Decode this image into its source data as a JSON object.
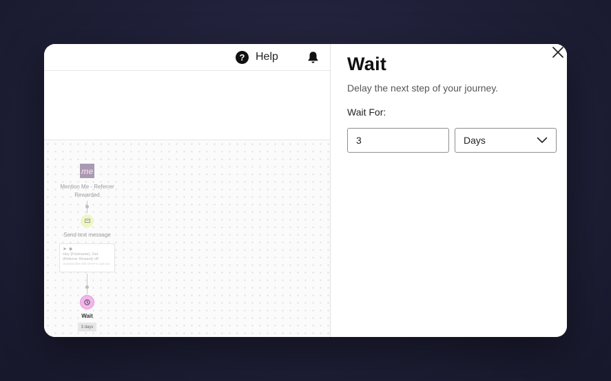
{
  "header": {
    "help_label": "Help",
    "help_icon": "question-circle-icon",
    "bell_icon": "bell-icon"
  },
  "journey": {
    "trigger": {
      "logo_text": "me",
      "title": "Mention Me - Referrer Rewarded"
    },
    "message": {
      "title": "Send text message",
      "preview": "Hey {Firstname}, Get {Referrer Reward} off",
      "preview_sub": "Unsubscribe with STOP to opt-out"
    },
    "wait": {
      "title": "Wait",
      "badge": "3 days"
    }
  },
  "panel": {
    "title": "Wait",
    "description": "Delay the next step of your journey.",
    "wait_for_label": "Wait For:",
    "amount_value": "3",
    "unit_value": "Days",
    "close_icon": "close-icon"
  },
  "colors": {
    "backdrop": "#1f2038",
    "wait_node": "#f2b6ea",
    "message_node": "#eef6c4",
    "logo_bg": "#a79bb1"
  }
}
